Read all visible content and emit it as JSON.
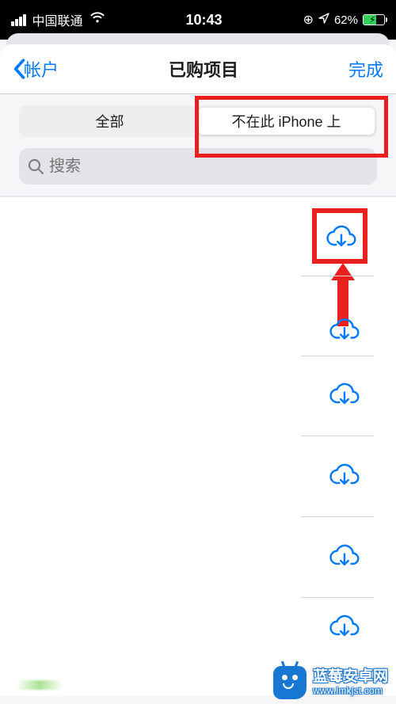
{
  "status": {
    "carrier": "中国联通",
    "time": "10:43",
    "orient_glyph": "⊕",
    "location_glyph": "➤",
    "battery_pct": "62%"
  },
  "nav": {
    "back_label": "帐户",
    "title": "已购项目",
    "done_label": "完成"
  },
  "segmented": {
    "all": "全部",
    "not_on_device": "不在此 iPhone 上"
  },
  "search": {
    "placeholder": "搜索"
  },
  "icons": {
    "cloud_download": "cloud-download-icon"
  },
  "colors": {
    "tint": "#007aff",
    "annotation": "#e9201e",
    "battery_fill": "#31d158"
  },
  "list": {
    "rows": 6
  },
  "watermark": {
    "title": "蓝莓安卓网",
    "url": "www.lmkjst.com"
  }
}
